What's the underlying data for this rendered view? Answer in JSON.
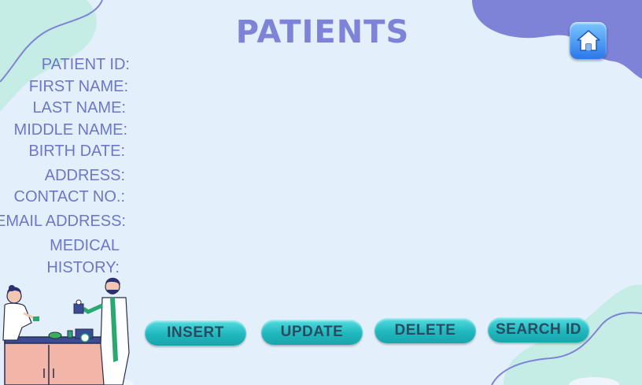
{
  "header": {
    "title": "PATIENTS"
  },
  "nav": {
    "home_icon": "home-icon"
  },
  "form": {
    "labels": {
      "patient_id": "PATIENT ID:",
      "first_name": "FIRST NAME:",
      "last_name": "LAST NAME:",
      "middle_name": "MIDDLE NAME:",
      "birth_date": "BIRTH DATE:",
      "address": "ADDRESS:",
      "contact_no": "CONTACT NO.:",
      "email_address": "EMAIL ADDRESS:",
      "medical_history_1": "MEDICAL",
      "medical_history_2": "HISTORY:"
    }
  },
  "actions": {
    "insert": "INSERT",
    "update": "UPDATE",
    "delete": "DELETE",
    "search_id": "SEARCH ID"
  },
  "colors": {
    "background": "#e3f0fb",
    "accent_purple": "#7e83d7",
    "accent_teal": "#1fb8be",
    "blob_mint": "#c6ece6"
  }
}
